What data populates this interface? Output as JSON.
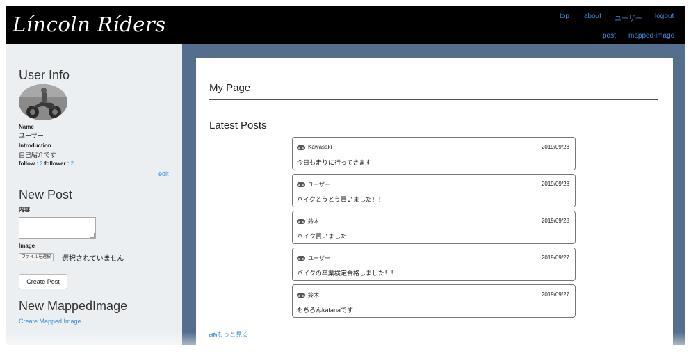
{
  "header": {
    "logo": "Líncoln Ríders",
    "nav": {
      "top": "top",
      "about": "about",
      "user": "ユーザー",
      "logout": "logout",
      "post": "post",
      "mapped_image": "mapped image"
    }
  },
  "sidebar": {
    "user_info_title": "User Info",
    "name_label": "Name",
    "name_value": "ユーザー",
    "intro_label": "Introduction",
    "intro_value": "自己紹介です",
    "follow_label": "follow : ",
    "follow_count": "2",
    "follower_label": " follower : ",
    "follower_count": "2",
    "edit_link": "edit",
    "new_post_title": "New Post",
    "content_label": "内容",
    "image_label": "Image",
    "file_button": "ファイルを選択",
    "file_status": "選択されていません",
    "create_post_button": "Create Post",
    "new_mapped_title": "New MappedImage",
    "create_mapped_link": "Create Mapped Image"
  },
  "main": {
    "page_title": "My Page",
    "latest_posts_title": "Latest Posts",
    "posts": [
      {
        "author": "Kawasaki",
        "date": "2019/09/28",
        "body": "今日も走りに行ってきます"
      },
      {
        "author": "ユーザー",
        "date": "2019/09/28",
        "body": "バイクとうとう買いました！！"
      },
      {
        "author": "鈴木",
        "date": "2019/09/28",
        "body": "バイク買いました"
      },
      {
        "author": "ユーザー",
        "date": "2019/09/27",
        "body": "バイクの卒業検定合格しました！！"
      },
      {
        "author": "鈴木",
        "date": "2019/09/27",
        "body": "もちろんkatanaです"
      }
    ],
    "more_link": "もっと見る",
    "more_icon": "motorcycle-icon"
  },
  "colors": {
    "header_bg": "#000000",
    "link": "#3d8edc",
    "main_bg": "#556e8e",
    "sidebar_bg": "#eceff2"
  }
}
